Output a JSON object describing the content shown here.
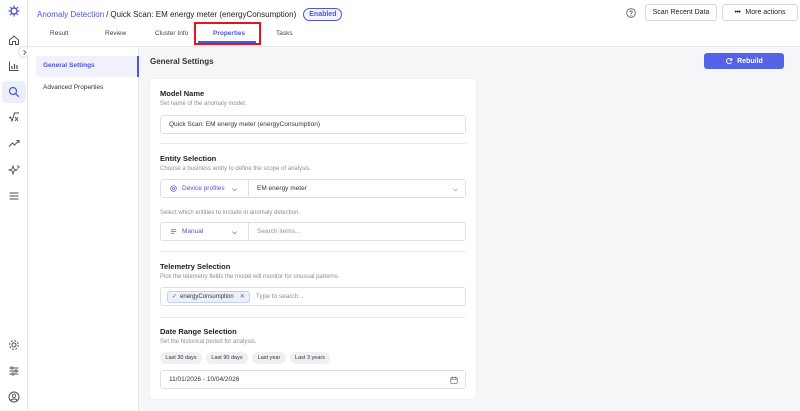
{
  "header": {
    "breadcrumb_link": "Anomaly Detection",
    "breadcrumb_sep": "/",
    "breadcrumb_current": "Quick Scan: EM energy meter (energyConsumption)",
    "status_badge": "Enabled",
    "scan_button": "Scan Recent Data",
    "more_button": "More actions"
  },
  "tabs": [
    {
      "label": "Result"
    },
    {
      "label": "Review"
    },
    {
      "label": "Cluster Info"
    },
    {
      "label": "Properties"
    },
    {
      "label": "Tasks"
    }
  ],
  "subnav": {
    "items": [
      {
        "label": "General Settings"
      },
      {
        "label": "Advanced Properties"
      }
    ]
  },
  "main": {
    "section_title": "General Settings",
    "rebuild_button": "Rebuild",
    "model_name": {
      "heading": "Model Name",
      "hint": "Set name of the anomaly model.",
      "value": "Quick Scan: EM energy meter (energyConsumption)"
    },
    "entity_selection": {
      "heading": "Entity Selection",
      "hint": "Choose a business entity to define the scope of analysis.",
      "type_value": "Device profiles",
      "profile_value": "EM energy meter",
      "entities_hint": "Select which entities to include in anomaly detection.",
      "mode_value": "Manual",
      "search_placeholder": "Search items..."
    },
    "telemetry_selection": {
      "heading": "Telemetry Selection",
      "hint": "Pick the telemetry fields the model will monitor for unusual patterns.",
      "chip": "energyConsumption",
      "placeholder": "Type to search..."
    },
    "date_range": {
      "heading": "Date Range Selection",
      "hint": "Set the historical period for analysis.",
      "presets": [
        "Last 30 days",
        "Last 90 days",
        "Last year",
        "Last 3 years"
      ],
      "value": "11/01/2026 - 10/04/2026"
    }
  },
  "colors": {
    "accent": "#4d56d6",
    "button_primary": "#5462e6",
    "highlight_box": "#e0151f"
  },
  "icons": [
    "app-logo-icon",
    "home-icon",
    "chart-icon",
    "search-icon",
    "formula-icon",
    "trend-icon",
    "sparkle-icon",
    "menu-icon",
    "gear-icon",
    "sliders-icon",
    "user-icon",
    "help-icon",
    "refresh-icon",
    "calendar-icon"
  ]
}
